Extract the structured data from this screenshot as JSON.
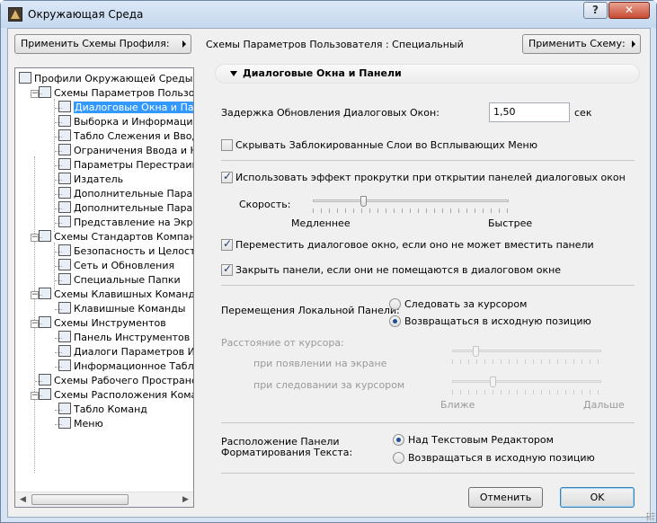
{
  "window": {
    "title": "Окружающая Среда",
    "help": "?",
    "close": "✕"
  },
  "toolbar": {
    "apply_profile": "Применить Схемы Профиля:",
    "scheme_label": "Схемы Параметров Пользователя : Специальный",
    "apply_scheme": "Применить Схему:"
  },
  "tree": [
    {
      "label": "Профили Окружающей Среды",
      "icon": "profiles-icon"
    },
    {
      "label": "Схемы Параметров Пользоват",
      "icon": "user-schemes-icon"
    },
    {
      "label": "Диалоговые Окна и Панел",
      "icon": "dialogs-icon",
      "selected": true
    },
    {
      "label": "Выборка и Информация об",
      "icon": "selection-icon"
    },
    {
      "label": "Табло Слежения и Ввод Ко",
      "icon": "tracker-icon"
    },
    {
      "label": "Ограничения Ввода и Напр",
      "icon": "constraints-icon"
    },
    {
      "label": "Параметры Перестраивани",
      "icon": "redraw-icon"
    },
    {
      "label": "Издатель",
      "icon": "publisher-icon"
    },
    {
      "label": "Дополнительные Параметр",
      "icon": "more-settings-icon"
    },
    {
      "label": "Дополнительные Параметр",
      "icon": "more-settings-icon"
    },
    {
      "label": "Представление на Экране",
      "icon": "display-icon"
    },
    {
      "label": "Схемы Стандартов Компании",
      "icon": "company-schemes-icon"
    },
    {
      "label": "Безопасность и Целостнос",
      "icon": "safety-icon"
    },
    {
      "label": "Сеть и Обновления",
      "icon": "network-icon"
    },
    {
      "label": "Специальные Папки",
      "icon": "folder-icon"
    },
    {
      "label": "Схемы Клавишных Команд",
      "icon": "keyboard-schemes-icon"
    },
    {
      "label": "Клавишные Команды",
      "icon": "keyboard-icon"
    },
    {
      "label": "Схемы Инструментов",
      "icon": "tool-schemes-icon"
    },
    {
      "label": "Панель Инструментов",
      "icon": "toolbox-icon"
    },
    {
      "label": "Диалоги Параметров Инстр",
      "icon": "tool-dialogs-icon"
    },
    {
      "label": "Информационное Табло",
      "icon": "info-box-icon"
    },
    {
      "label": "Схемы Рабочего Пространства",
      "icon": "workspace-icon"
    },
    {
      "label": "Схемы Расположения Команд",
      "icon": "command-layout-icon"
    },
    {
      "label": "Табло Команд",
      "icon": "toolbars-icon"
    },
    {
      "label": "Меню",
      "icon": "menus-icon"
    }
  ],
  "section": {
    "title": "Диалоговые Окна и Панели"
  },
  "delay": {
    "label": "Задержка Обновления Диалоговых Окон:",
    "value": "1,50",
    "unit": "сек"
  },
  "hide_locked": {
    "label": "Скрывать Заблокированные Слои во Всплывающих Меню",
    "checked": false
  },
  "scroll_effect": {
    "label": "Использовать эффект прокрутки при открытии панелей диалоговых окон",
    "checked": true
  },
  "speed": {
    "label": "Скорость:",
    "slow": "Медленнее",
    "fast": "Быстрее",
    "value": 0.25
  },
  "move_dialog": {
    "label": "Переместить диалоговое окно, если оно не может вместить панели",
    "checked": true
  },
  "close_panels": {
    "label": "Закрыть панели, если они не помещаются в диалоговом окне",
    "checked": true
  },
  "local_panel": {
    "label": "Перемещения Локальной Панели:",
    "options": [
      "Следовать за курсором",
      "Возвращаться в исходную позицию"
    ],
    "selected": 1
  },
  "distance": {
    "label": "Расстояние от курсора:",
    "on_appear": "при появлении на экране",
    "on_follow": "при следовании за курсором",
    "near": "Ближе",
    "far": "Дальше"
  },
  "format_panel": {
    "label1": "Расположение Панели",
    "label2": "Форматирования Текста:",
    "options": [
      "Над Текстовым Редактором",
      "Возвращаться в исходную позицию"
    ],
    "selected": 0
  },
  "buttons": {
    "cancel": "Отменить",
    "ok": "OK"
  },
  "colors": {
    "selection": "#3399ff",
    "titlebar": "#c5d8ee"
  }
}
